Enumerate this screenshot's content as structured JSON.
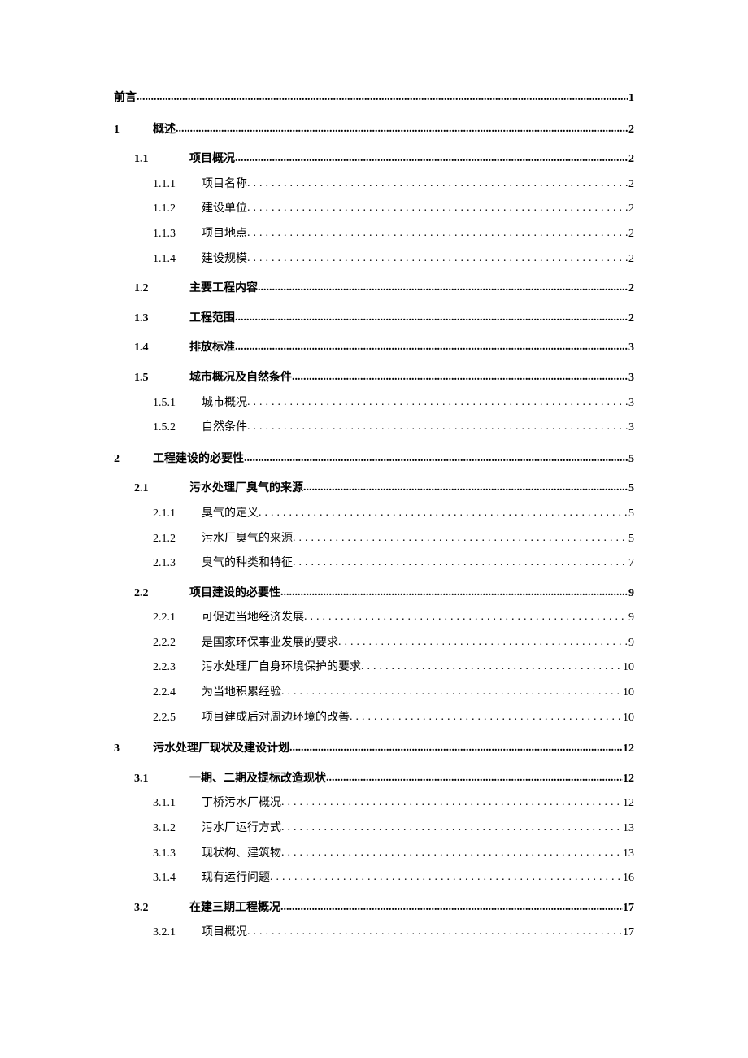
{
  "toc": [
    {
      "level": 0,
      "label": "",
      "title": "前言",
      "page": "1",
      "leader": "tight"
    },
    {
      "level": 1,
      "label": "1",
      "title": "概述",
      "page": "2",
      "leader": "tight"
    },
    {
      "level": 2,
      "label": "1.1",
      "title": "项目概况",
      "page": "2",
      "leader": "tight"
    },
    {
      "level": 3,
      "label": "1.1.1",
      "title": "项目名称",
      "page": "2",
      "leader": "dot"
    },
    {
      "level": 3,
      "label": "1.1.2",
      "title": "建设单位",
      "page": "2",
      "leader": "dot"
    },
    {
      "level": 3,
      "label": "1.1.3",
      "title": "项目地点",
      "page": "2",
      "leader": "dot"
    },
    {
      "level": 3,
      "label": "1.1.4",
      "title": "建设规模",
      "page": "2",
      "leader": "dot"
    },
    {
      "level": 2,
      "label": "1.2",
      "title": "主要工程内容",
      "page": "2",
      "leader": "tight"
    },
    {
      "level": 2,
      "label": "1.3",
      "title": "工程范围",
      "page": "2",
      "leader": "tight"
    },
    {
      "level": 2,
      "label": "1.4",
      "title": "排放标准",
      "page": "3",
      "leader": "tight"
    },
    {
      "level": 2,
      "label": "1.5",
      "title": "城市概况及自然条件",
      "page": "3",
      "leader": "tight"
    },
    {
      "level": 3,
      "label": "1.5.1",
      "title": "城市概况",
      "page": "3",
      "leader": "dot"
    },
    {
      "level": 3,
      "label": "1.5.2",
      "title": "自然条件",
      "page": "3",
      "leader": "dot"
    },
    {
      "level": 1,
      "label": "2",
      "title": "工程建设的必要性",
      "page": "5",
      "leader": "tight"
    },
    {
      "level": 2,
      "label": "2.1",
      "title": "污水处理厂臭气的来源",
      "page": "5",
      "leader": "tight"
    },
    {
      "level": 3,
      "label": "2.1.1",
      "title": "臭气的定义",
      "page": "5",
      "leader": "dot"
    },
    {
      "level": 3,
      "label": "2.1.2",
      "title": "污水厂臭气的来源",
      "page": "5",
      "leader": "dot"
    },
    {
      "level": 3,
      "label": "2.1.3",
      "title": "臭气的种类和特征",
      "page": "7",
      "leader": "dot"
    },
    {
      "level": 2,
      "label": "2.2",
      "title": "项目建设的必要性",
      "page": "9",
      "leader": "tight"
    },
    {
      "level": 3,
      "label": "2.2.1",
      "title": "可促进当地经济发展",
      "page": "9",
      "leader": "dot"
    },
    {
      "level": 3,
      "label": "2.2.2",
      "title": "是国家环保事业发展的要求",
      "page": "9",
      "leader": "dot"
    },
    {
      "level": 3,
      "label": "2.2.3",
      "title": "污水处理厂自身环境保护的要求",
      "page": "10",
      "leader": "dot"
    },
    {
      "level": 3,
      "label": "2.2.4",
      "title": "为当地积累经验",
      "page": "10",
      "leader": "dot"
    },
    {
      "level": 3,
      "label": "2.2.5",
      "title": "项目建成后对周边环境的改善",
      "page": "10",
      "leader": "dot"
    },
    {
      "level": 1,
      "label": "3",
      "title": "污水处理厂现状及建设计划",
      "page": "12",
      "leader": "tight"
    },
    {
      "level": 2,
      "label": "3.1",
      "title": "一期、二期及提标改造现状",
      "page": "12",
      "leader": "tight"
    },
    {
      "level": 3,
      "label": "3.1.1",
      "title": "丁桥污水厂概况",
      "page": "12",
      "leader": "dot"
    },
    {
      "level": 3,
      "label": "3.1.2",
      "title": "污水厂运行方式",
      "page": "13",
      "leader": "dot"
    },
    {
      "level": 3,
      "label": "3.1.3",
      "title": "现状构、建筑物",
      "page": "13",
      "leader": "dot"
    },
    {
      "level": 3,
      "label": "3.1.4",
      "title": "现有运行问题",
      "page": "16",
      "leader": "dot"
    },
    {
      "level": 2,
      "label": "3.2",
      "title": "在建三期工程概况",
      "page": "17",
      "leader": "tight"
    },
    {
      "level": 3,
      "label": "3.2.1",
      "title": "项目概况",
      "page": "17",
      "leader": "dot"
    }
  ]
}
